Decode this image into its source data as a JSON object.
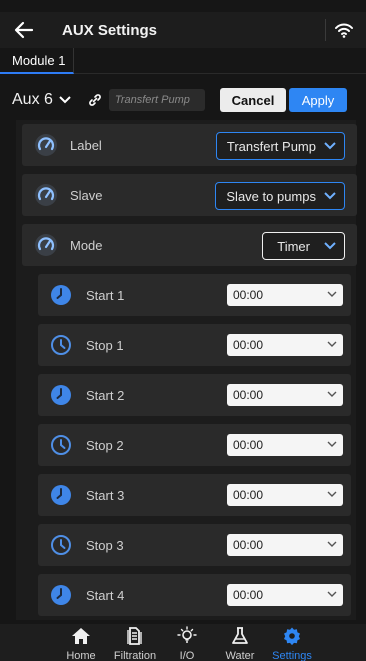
{
  "header": {
    "title": "AUX Settings",
    "back_icon": "back-arrow-icon",
    "wifi_icon": "wifi-icon"
  },
  "tabs": [
    {
      "label": "Module 1",
      "active": true
    }
  ],
  "aux": {
    "selected": "Aux 6",
    "name_placeholder": "Transfert Pump",
    "cancel_label": "Cancel",
    "apply_label": "Apply"
  },
  "settings": [
    {
      "label": "Label",
      "value": "Transfert Pump"
    },
    {
      "label": "Slave",
      "value": "Slave to pumps"
    },
    {
      "label": "Mode",
      "value": "Timer"
    }
  ],
  "timers": [
    {
      "label": "Start 1",
      "value": "00:00",
      "kind": "start"
    },
    {
      "label": "Stop 1",
      "value": "00:00",
      "kind": "stop"
    },
    {
      "label": "Start 2",
      "value": "00:00",
      "kind": "start"
    },
    {
      "label": "Stop 2",
      "value": "00:00",
      "kind": "stop"
    },
    {
      "label": "Start 3",
      "value": "00:00",
      "kind": "start"
    },
    {
      "label": "Stop 3",
      "value": "00:00",
      "kind": "stop"
    },
    {
      "label": "Start 4",
      "value": "00:00",
      "kind": "start"
    }
  ],
  "nav": [
    {
      "label": "Home",
      "icon": "home-icon"
    },
    {
      "label": "Filtration",
      "icon": "filtration-icon"
    },
    {
      "label": "I/O",
      "icon": "bulb-icon"
    },
    {
      "label": "Water",
      "icon": "flask-icon"
    },
    {
      "label": "Settings",
      "icon": "gear-icon",
      "active": true
    }
  ],
  "colors": {
    "accent": "#2e86f3",
    "background": "#161616",
    "row": "#2a2a2a"
  }
}
